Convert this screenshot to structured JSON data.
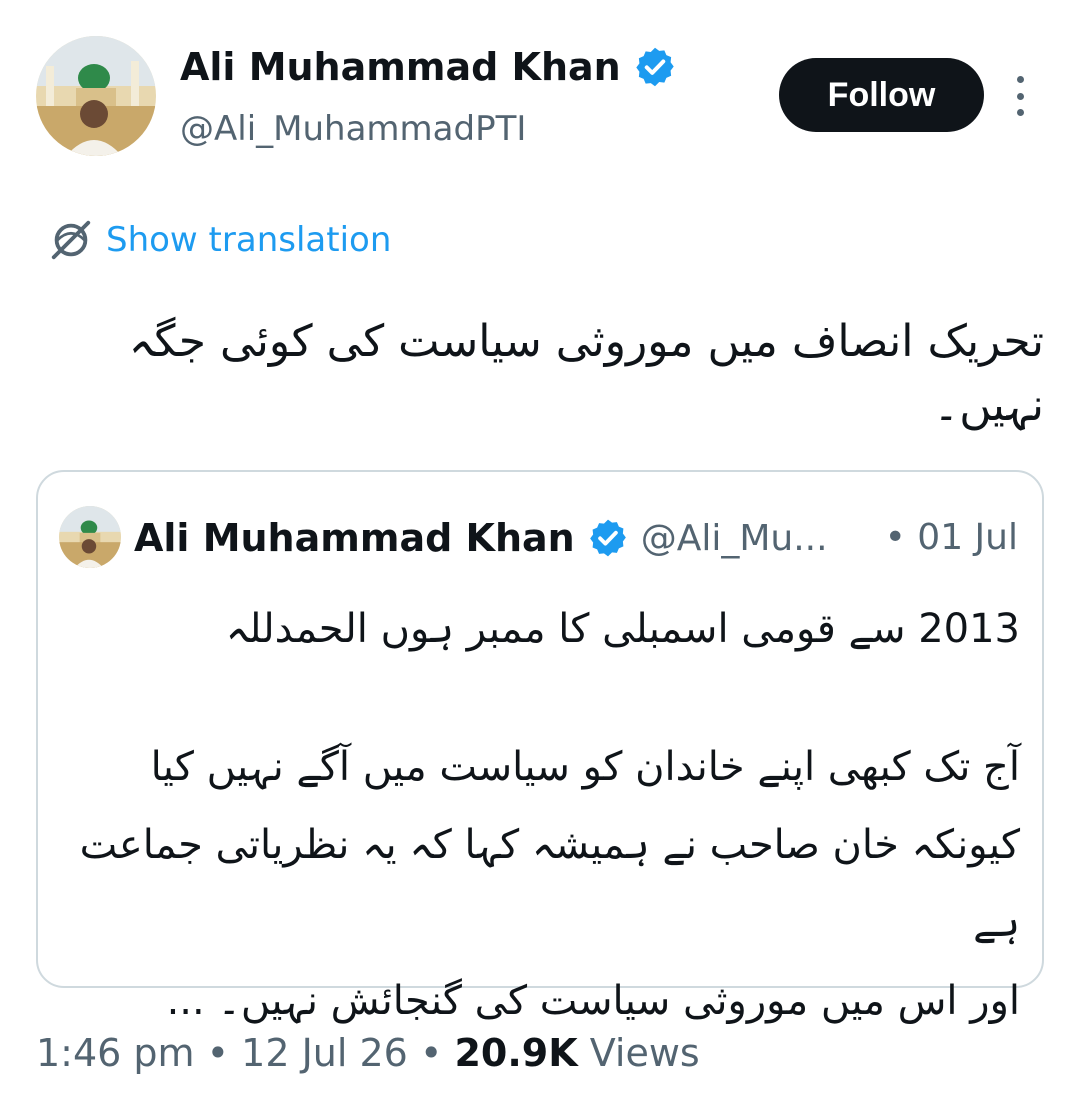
{
  "author": {
    "name": "Ali Muhammad Khan",
    "handle": "@Ali_MuhammadPTI",
    "verified": true
  },
  "actions": {
    "follow_label": "Follow",
    "more_icon": "more-vertical-icon"
  },
  "translation": {
    "label": "Show translation",
    "icon": "globe-translate-icon"
  },
  "tweet": {
    "text": "تحریک انصاف میں موروثی سیاست کی کوئی جگہ نہیں۔"
  },
  "quoted": {
    "name": "Ali Muhammad Khan",
    "handle": "@Ali_Mu...",
    "date": "• 01 Jul",
    "line1": "2013 سے قومی اسمبلی کا ممبر ہوں الحمدللہ",
    "line2": "آج تک کبھی اپنے خاندان کو سیاست میں آگے نہیں کیا",
    "line3": "کیونکہ خان صاحب نے ہمیشہ کہا کہ یہ نظریاتی جماعت ہے",
    "line4": "اور اس میں موروثی سیاست کی گنجائش نہیں۔ ..."
  },
  "meta": {
    "time": "1:46 pm",
    "sep1": " • ",
    "date": "12 Jul 26",
    "sep2": " • ",
    "views_count": "20.9K",
    "views_label": "Views"
  },
  "colors": {
    "accent": "#1d9bf0",
    "text": "#0f1419",
    "secondary": "#536471",
    "border": "#cfd9de"
  }
}
